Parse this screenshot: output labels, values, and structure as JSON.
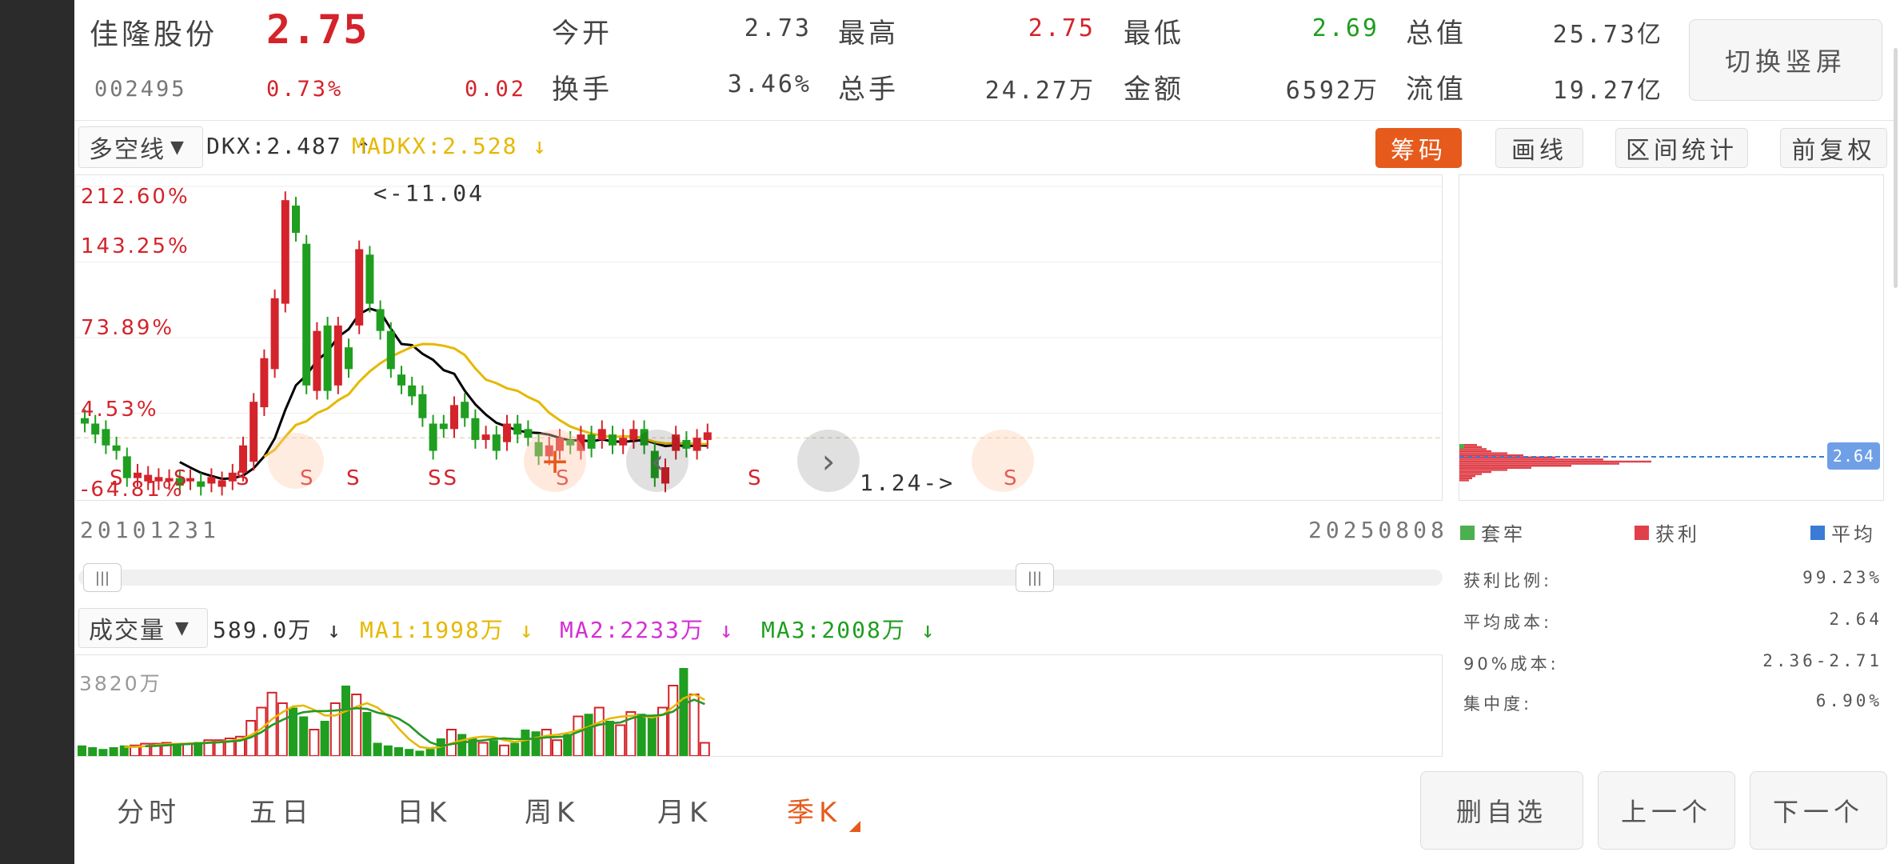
{
  "stock": {
    "name": "佳隆股份",
    "price": "2.75",
    "code": "002495",
    "change_pct": "0.73%",
    "change": "0.02"
  },
  "quote": {
    "open_label": "今开",
    "open": "2.73",
    "high_label": "最高",
    "high": "2.75",
    "low_label": "最低",
    "low": "2.69",
    "mktcap_label": "总值",
    "mktcap": "25.73亿",
    "turnover_label": "换手",
    "turnover": "3.46%",
    "volume_label": "总手",
    "volume": "24.27万",
    "amount_label": "金额",
    "amount": "6592万",
    "float_label": "流值",
    "float": "19.27亿"
  },
  "buttons": {
    "switch_portrait": "切换竖屏",
    "chips": "筹码",
    "draw": "画线",
    "range_stats": "区间统计",
    "adjust": "前复权",
    "remove_watch": "删自选",
    "prev": "上一个",
    "next": "下一个"
  },
  "indicator": {
    "selector": "多空线",
    "dkx": "DKX:2.487 ↑",
    "madkx": "MADKX:2.528 ↓"
  },
  "price_axis": [
    "212.60%",
    "143.25%",
    "73.89%",
    "4.53%",
    "-64.81%"
  ],
  "annotations": {
    "high_marker": "<-11.04",
    "low_marker": "1.24->"
  },
  "s_marks": [
    "S",
    "S",
    "S",
    "S",
    "S",
    "SS",
    "S",
    "S",
    "S"
  ],
  "dates": {
    "start": "20101231",
    "end": "20250808"
  },
  "volume": {
    "selector": "成交量",
    "current": "589.0万 ↓",
    "ma1": "MA1:1998万 ↓",
    "ma2": "MA2:2233万 ↓",
    "ma3": "MA3:2008万 ↓",
    "max_label": "3820万"
  },
  "chips": {
    "price_tag": "2.64",
    "legend_trapped": "套牢",
    "legend_profit": "获利",
    "legend_avg": "平均",
    "rows": [
      {
        "label": "获利比例:",
        "value": "99.23%"
      },
      {
        "label": "平均成本:",
        "value": "2.64"
      },
      {
        "label": "90%成本:",
        "value": "2.36-2.71"
      },
      {
        "label": "集中度:",
        "value": "6.90%"
      }
    ]
  },
  "tabs": [
    "分时",
    "五日",
    "日K",
    "周K",
    "月K",
    "季K"
  ],
  "colors": {
    "up": "#d4232b",
    "down": "#1f9e1f",
    "accent": "#e65a1b",
    "dkx": "#000000",
    "madkx": "#e6b800",
    "ma2": "#d42fd4"
  },
  "chart_data": {
    "type": "candlestick",
    "ylabel_ticks": [
      "212.60%",
      "143.25%",
      "73.89%",
      "4.53%",
      "-64.81%"
    ],
    "date_range": [
      "20101231",
      "20250808"
    ],
    "candles_pct": [
      {
        "o": 0,
        "c": -5
      },
      {
        "o": -5,
        "c": -15
      },
      {
        "o": -10,
        "c": -25
      },
      {
        "o": -25,
        "c": -30
      },
      {
        "o": -35,
        "c": -55
      },
      {
        "o": -55,
        "c": -50
      },
      {
        "o": -58,
        "c": -52
      },
      {
        "o": -58,
        "c": -54
      },
      {
        "o": -58,
        "c": -55
      },
      {
        "o": -55,
        "c": -62
      },
      {
        "o": -58,
        "c": -55
      },
      {
        "o": -58,
        "c": -63
      },
      {
        "o": -60,
        "c": -54
      },
      {
        "o": -63,
        "c": -57
      },
      {
        "o": -58,
        "c": -50
      },
      {
        "o": -50,
        "c": -25
      },
      {
        "o": -40,
        "c": 15
      },
      {
        "o": 10,
        "c": 55
      },
      {
        "o": 45,
        "c": 110
      },
      {
        "o": 105,
        "c": 200
      },
      {
        "o": 195,
        "c": 170
      },
      {
        "o": 160,
        "c": 30
      },
      {
        "o": 25,
        "c": 80
      },
      {
        "o": 85,
        "c": 25
      },
      {
        "o": 30,
        "c": 85
      },
      {
        "o": 65,
        "c": 45
      },
      {
        "o": 85,
        "c": 155
      },
      {
        "o": 150,
        "c": 105
      },
      {
        "o": 100,
        "c": 80
      },
      {
        "o": 80,
        "c": 45
      },
      {
        "o": 40,
        "c": 30
      },
      {
        "o": 30,
        "c": 20
      },
      {
        "o": 22,
        "c": 0
      },
      {
        "o": -5,
        "c": -30
      },
      {
        "o": -5,
        "c": -10
      },
      {
        "o": -10,
        "c": 12
      },
      {
        "o": 15,
        "c": 0
      },
      {
        "o": 0,
        "c": -20
      },
      {
        "o": -20,
        "c": -15
      },
      {
        "o": -15,
        "c": -30
      },
      {
        "o": -22,
        "c": -5
      },
      {
        "o": -5,
        "c": -15
      },
      {
        "o": -10,
        "c": -18
      },
      {
        "o": -22,
        "c": -35
      },
      {
        "o": -35,
        "c": -25
      },
      {
        "o": -30,
        "c": -18
      },
      {
        "o": -20,
        "c": -25
      },
      {
        "o": -30,
        "c": -15
      },
      {
        "o": -15,
        "c": -28
      },
      {
        "o": -20,
        "c": -10
      },
      {
        "o": -15,
        "c": -25
      },
      {
        "o": -25,
        "c": -18
      },
      {
        "o": -20,
        "c": -10
      },
      {
        "o": -10,
        "c": -25
      },
      {
        "o": -30,
        "c": -55
      },
      {
        "o": -60,
        "c": -45
      },
      {
        "o": -30,
        "c": -15
      },
      {
        "o": -20,
        "c": -28
      },
      {
        "o": -30,
        "c": -18
      },
      {
        "o": -20,
        "c": -13
      }
    ],
    "volume_pct": [
      12,
      10,
      8,
      10,
      12,
      12,
      14,
      14,
      15,
      14,
      14,
      16,
      18,
      18,
      20,
      22,
      40,
      55,
      72,
      60,
      55,
      45,
      30,
      40,
      60,
      80,
      70,
      50,
      15,
      12,
      10,
      8,
      6,
      8,
      20,
      30,
      25,
      20,
      15,
      18,
      12,
      15,
      30,
      28,
      30,
      18,
      25,
      45,
      48,
      55,
      40,
      35,
      50,
      48,
      45,
      55,
      80,
      100,
      70,
      15
    ]
  }
}
